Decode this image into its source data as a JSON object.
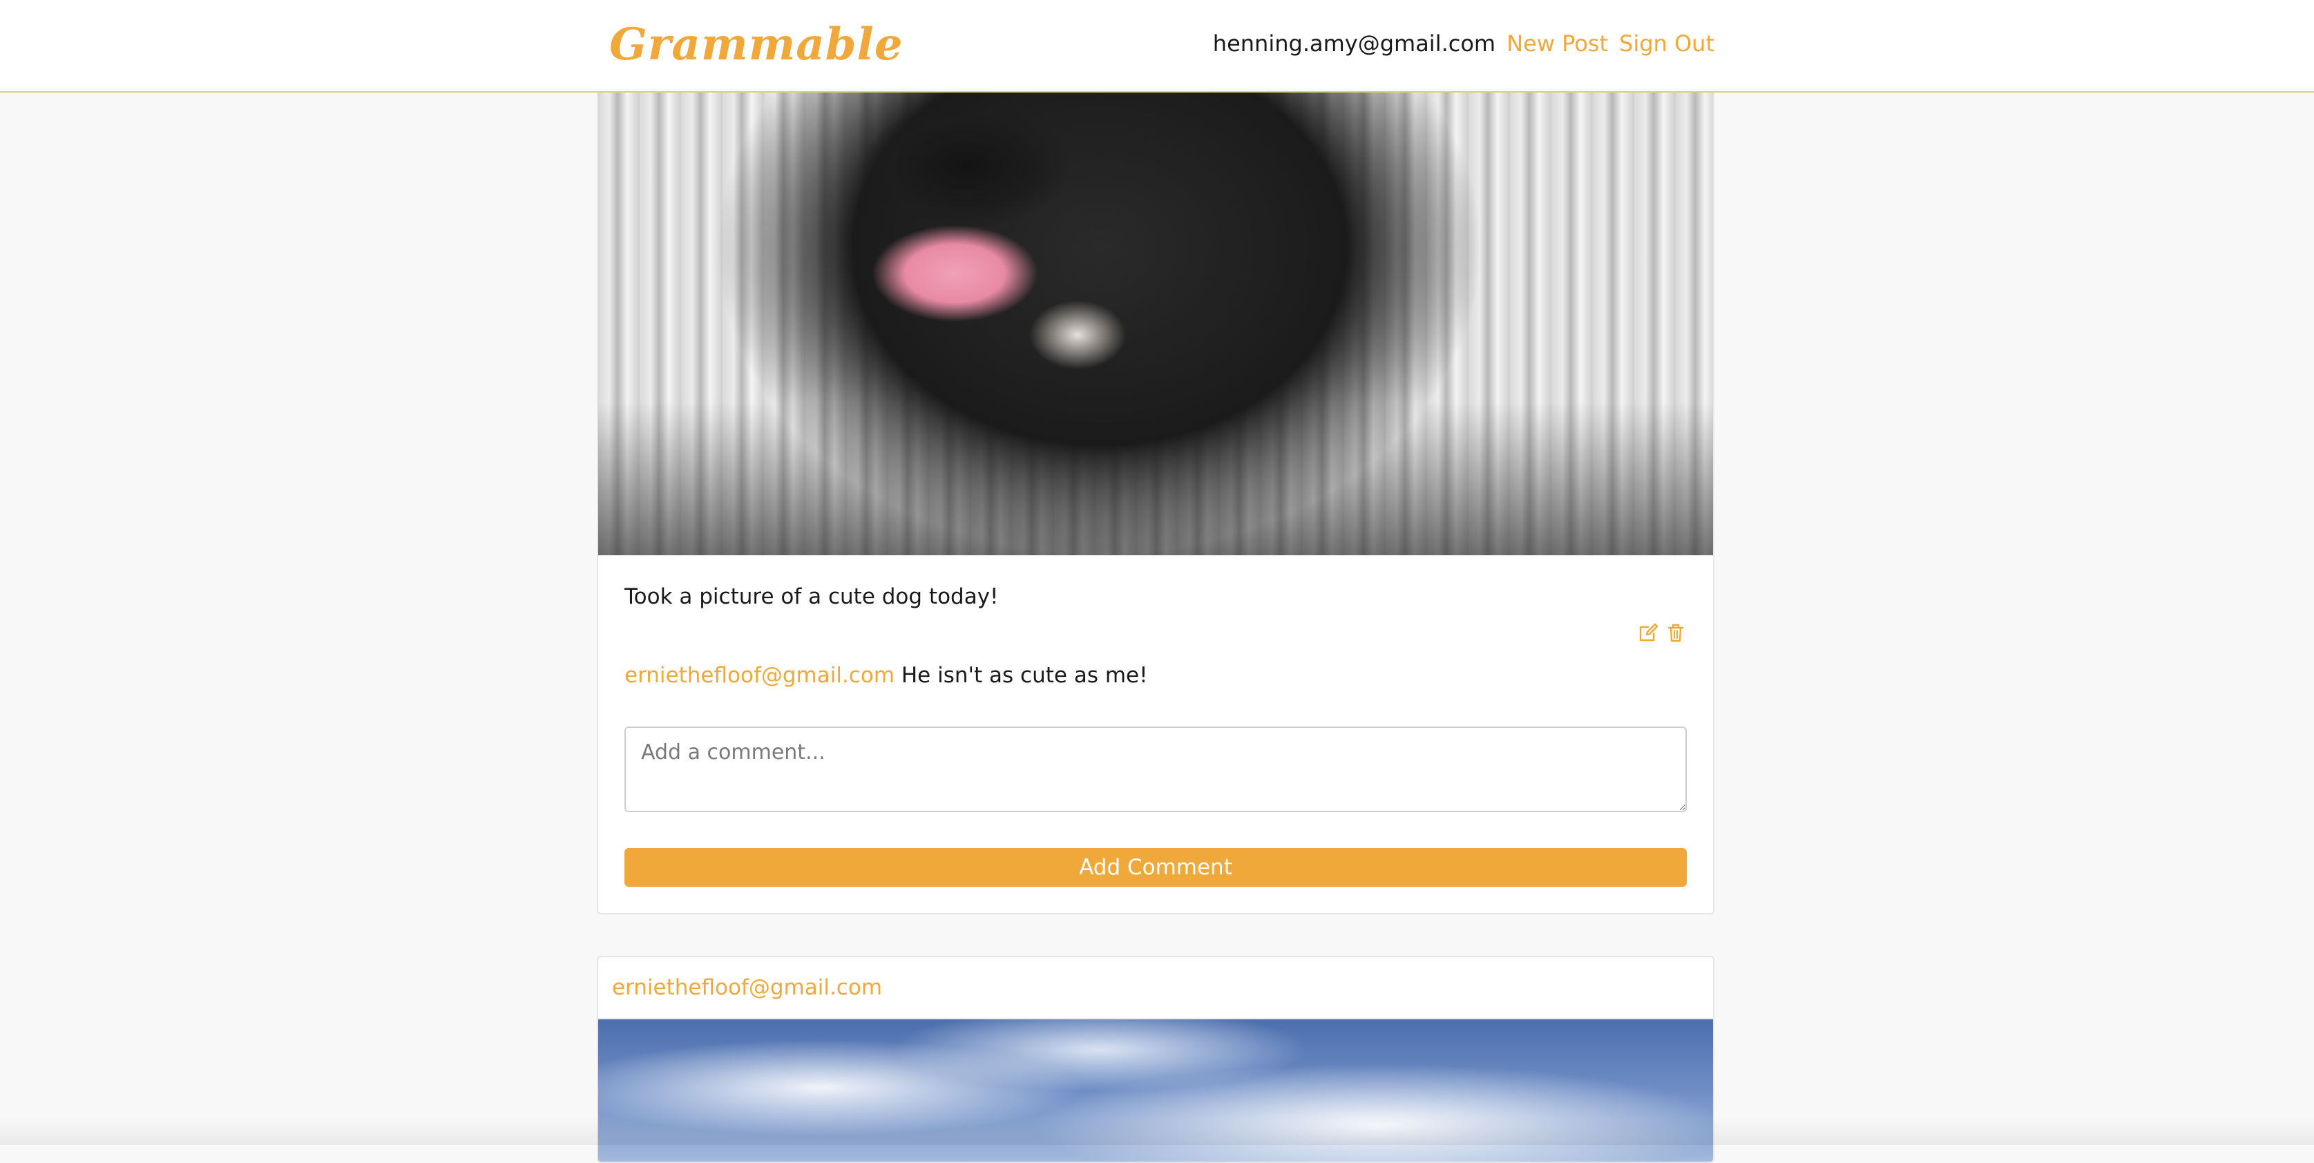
{
  "navbar": {
    "brand": "Grammable",
    "user_email": "henning.amy@gmail.com",
    "new_post_label": "New Post",
    "sign_out_label": "Sign Out"
  },
  "posts": [
    {
      "image": "dog-photo",
      "caption": "Took a picture of a cute dog today!",
      "actions": [
        "edit-icon",
        "trash-icon"
      ],
      "comments": [
        {
          "user": "erniethefloof@gmail.com",
          "text": "He isn't as cute as me!"
        }
      ],
      "comment_placeholder": "Add a comment...",
      "add_comment_label": "Add Comment"
    },
    {
      "user": "erniethefloof@gmail.com",
      "image": "sky-photo"
    }
  ],
  "colors": {
    "accent": "#f0a83a",
    "background": "#f8f8f8",
    "card": "#ffffff"
  }
}
